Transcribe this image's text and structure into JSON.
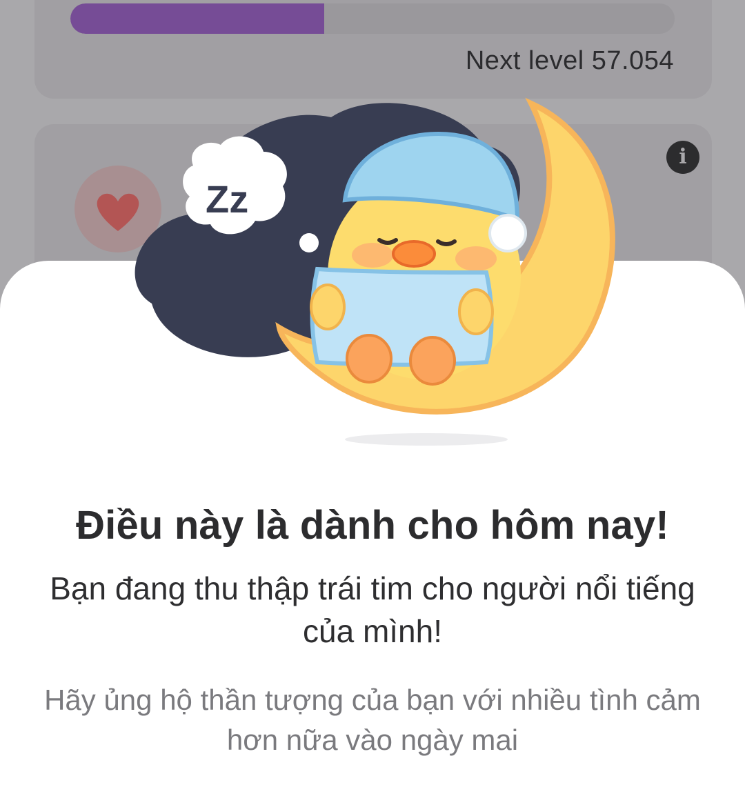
{
  "level": {
    "progress_fraction": 0.42,
    "next_level_text": "Next level 57.054"
  },
  "stats_card": {
    "info_icon": "info-icon",
    "heart_icon": "heart-icon"
  },
  "dialog": {
    "title": "Điều này là dành cho hôm nay!",
    "message": "Bạn đang thu thập trái tim cho người nổi tiếng của mình!",
    "hint": "Hãy ủng hộ thần tượng của bạn với nhiều tình cảm hơn nữa vào ngày mai",
    "illustration": "sleeping-duck-on-moon",
    "sleep_bubble_text": "Zz"
  },
  "colors": {
    "progress": "#764c96",
    "dim_background": "#a9a8ab",
    "title_text": "#2c2c2e",
    "hint_text": "#7a7a7e"
  }
}
